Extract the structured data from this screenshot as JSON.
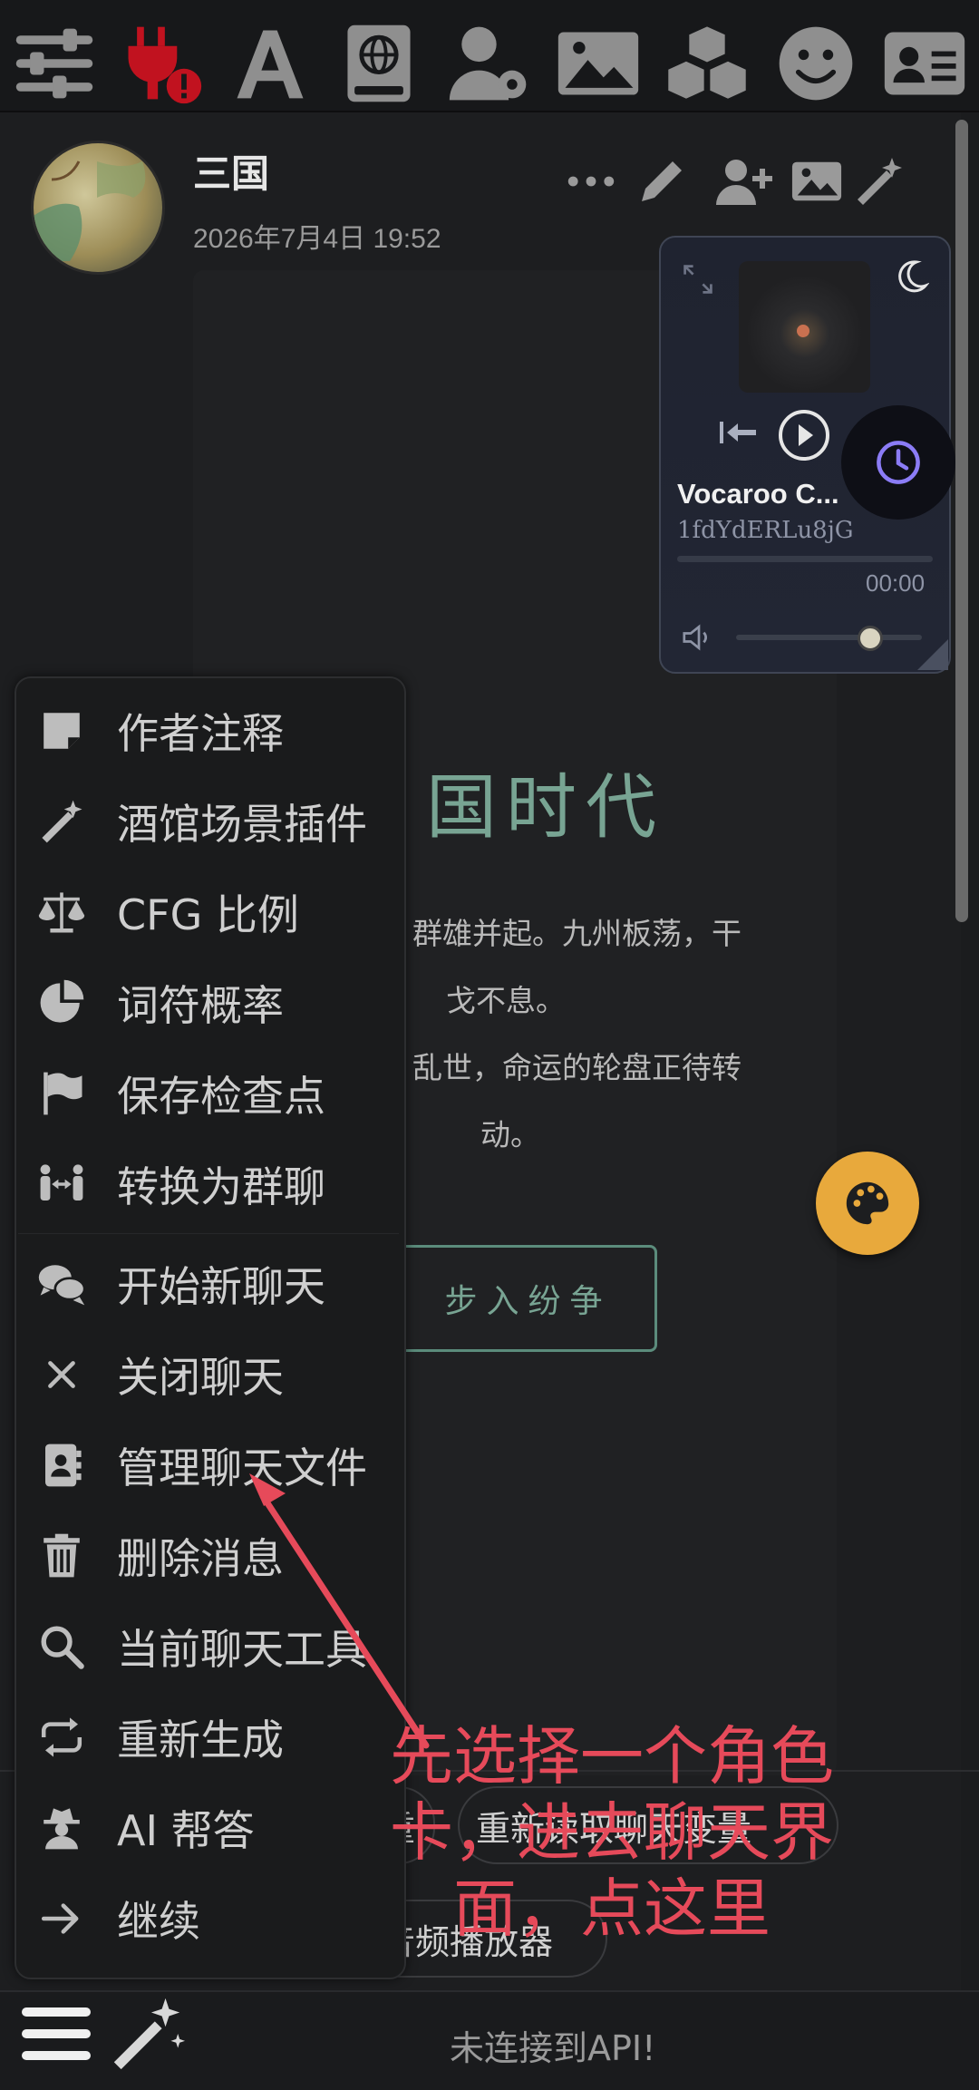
{
  "chat": {
    "character_name": "三国",
    "message_date": "2026年7月4日 19:52"
  },
  "card": {
    "title": "国时代",
    "lines": [
      "群雄并起。九州板荡，干",
      "戈不息。",
      "乱世，命运的轮盘正待转",
      "动。"
    ],
    "enter_button": "步入纷争"
  },
  "player": {
    "track_title": "Vocaroo C...",
    "track_id": "1fdYdERLu8jG",
    "time": "00:00",
    "volume_level": 0.72
  },
  "menu": {
    "items": [
      {
        "label": "作者注释",
        "icon": "note-icon"
      },
      {
        "label": "酒馆场景插件",
        "icon": "magic-wand-icon"
      },
      {
        "label": "CFG 比例",
        "icon": "scale-icon"
      },
      {
        "label": "词符概率",
        "icon": "pie-chart-icon"
      },
      {
        "label": "保存检查点",
        "icon": "flag-icon"
      },
      {
        "label": "转换为群聊",
        "icon": "people-arrows-icon"
      },
      {
        "label": "开始新聊天",
        "icon": "comments-icon"
      },
      {
        "label": "关闭聊天",
        "icon": "close-icon"
      },
      {
        "label": "管理聊天文件",
        "icon": "address-book-icon"
      },
      {
        "label": "删除消息",
        "icon": "trash-icon"
      },
      {
        "label": "当前聊天工具",
        "icon": "search-icon"
      },
      {
        "label": "重新生成",
        "icon": "repeat-icon"
      },
      {
        "label": "AI 帮答",
        "icon": "user-secret-icon"
      },
      {
        "label": "继续",
        "icon": "arrow-right-icon"
      }
    ]
  },
  "bottom": {
    "pill_1": "重",
    "pill_2": "重新读取聊天变量",
    "pill_3": "音频播放器",
    "status": "未连接到API!"
  },
  "annotation": {
    "line1": "先选择一个角色",
    "line2": "卡，进去聊天界",
    "line3": "面，点这里"
  },
  "colors": {
    "accent_red": "#e64a5a",
    "plug_red": "#c1121f",
    "card_teal": "#78a493",
    "palette_gold": "#e8a93c",
    "clock_purple": "#8b7cf6"
  }
}
